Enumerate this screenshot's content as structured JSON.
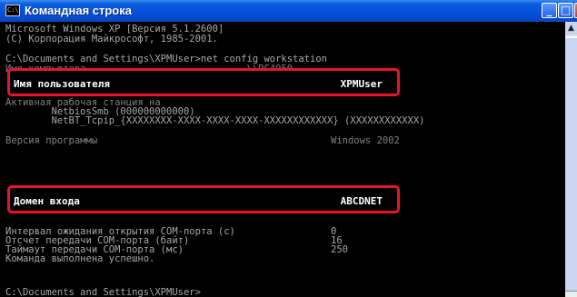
{
  "window": {
    "title": "Командная строка",
    "icon_label": "C:\\",
    "minimize": "_",
    "maximize": "□",
    "close": "x"
  },
  "console": {
    "lines": [
      "Microsoft Windows XP [Версия 5.1.2600]",
      "(С) Корпорация Майкрософт, 1985-2001.",
      "",
      "C:\\Documents and Settings\\XPMUser>net config workstation",
      "Имя компьютера                            \\\\PC4950"
    ],
    "user_label": "Имя пользователя",
    "user_value": "XPMUser",
    "active_station_label": "Активная рабочая станция на",
    "netbios_smb": "        NetbiosSmb (000000000000)",
    "netbt_tcpip": "        NetBT_Tcpip_{XXXXXXXX-XXXX-XXXX-XXXX-XXXXXXXXXXXX} (XXXXXXXXXXXX)",
    "version_label": "Версия программы",
    "version_value": "Windows 2002",
    "domain_label": "Домен входа",
    "domain_value": "ABCDNET",
    "com_timeout_label": "Интервал ожидания открытия COM-порта (с)",
    "com_timeout_value": "0",
    "com_count_label": "Отсчет передачи COM-порта (байт)",
    "com_count_value": "16",
    "com_delay_label": "Таймаут передачи COM-порта (мс)",
    "com_delay_value": "250",
    "completed": "Команда выполнена успешно.",
    "prompt": "C:\\Documents and Settings\\XPMUser>"
  },
  "scrollbar": {
    "up_arrow": "▲"
  }
}
